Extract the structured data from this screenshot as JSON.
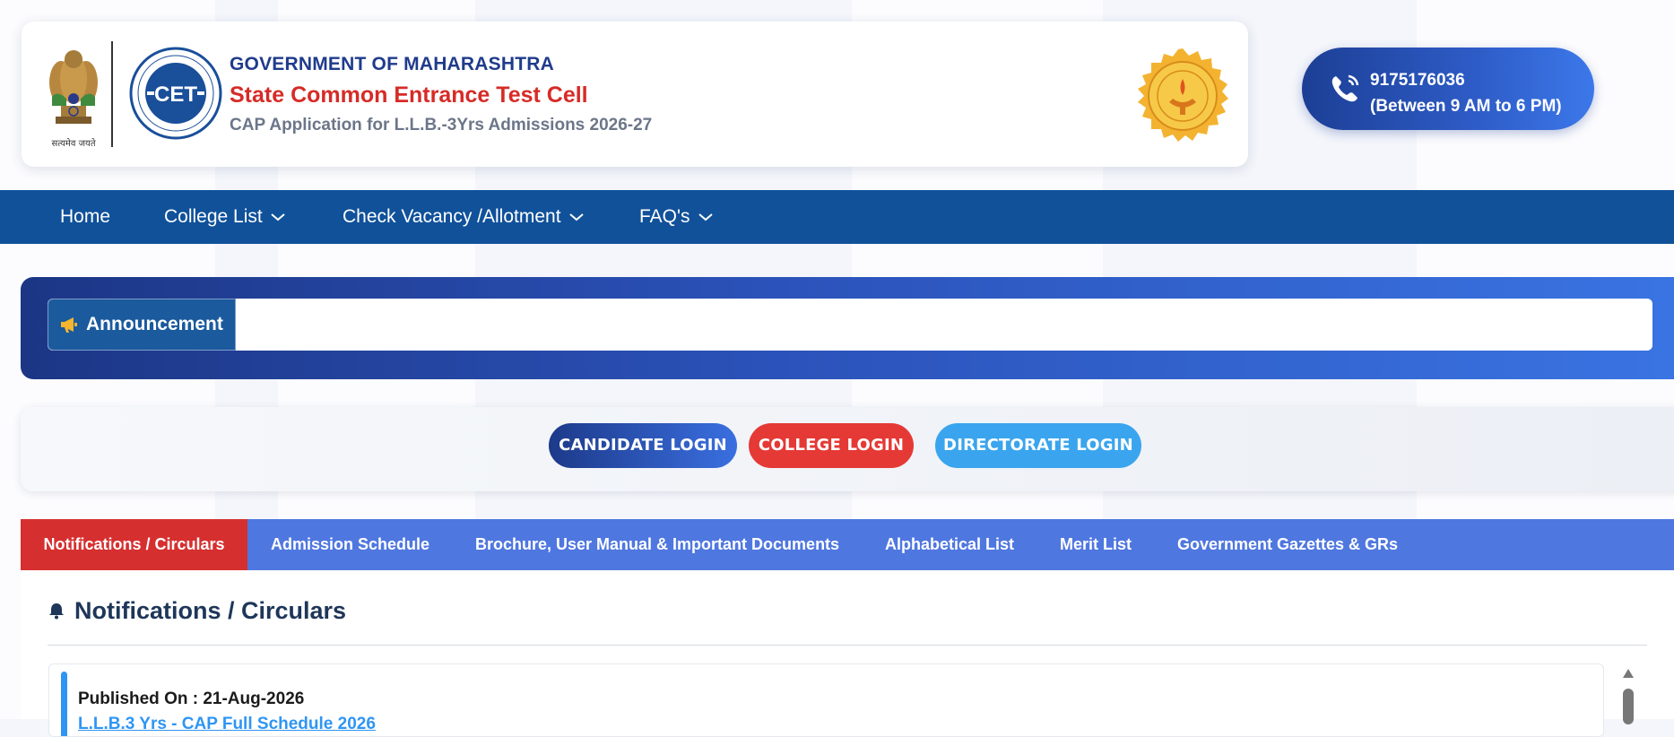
{
  "header": {
    "emblem_motto": "सत्यमेव जयते",
    "government": "GOVERNMENT OF MAHARASHTRA",
    "cell_name": "State Common Entrance Test Cell",
    "application_title": "CAP Application for L.L.B.-3Yrs Admissions 2026-27",
    "cet_logo_text": "CET"
  },
  "contact": {
    "phone": "9175176036",
    "hours": "(Between 9 AM to 6 PM)",
    "icon": "phone-icon"
  },
  "nav": {
    "home": "Home",
    "college_list": "College List",
    "check_vacancy": "Check Vacancy /Allotment",
    "faqs": "FAQ's"
  },
  "announcement": {
    "label": "Announcement",
    "icon": "megaphone-icon",
    "text": ""
  },
  "logins": {
    "candidate": "CANDIDATE LOGIN",
    "college": "COLLEGE LOGIN",
    "directorate": "DIRECTORATE LOGIN"
  },
  "tabs": [
    {
      "label": "Notifications / Circulars",
      "active": true
    },
    {
      "label": "Admission Schedule",
      "active": false
    },
    {
      "label": "Brochure, User Manual & Important Documents",
      "active": false
    },
    {
      "label": "Alphabetical List",
      "active": false
    },
    {
      "label": "Merit List",
      "active": false
    },
    {
      "label": "Government Gazettes & GRs",
      "active": false
    }
  ],
  "notifications": {
    "heading": "Notifications / Circulars",
    "items": [
      {
        "published": "Published On : 21-Aug-2026",
        "title": "L.L.B.3 Yrs - CAP Full Schedule 2026"
      }
    ]
  },
  "colors": {
    "nav": "#10519a",
    "accent_red": "#d62f2f",
    "tab_bar": "#4f77e0",
    "link_blue": "#2f95f3"
  }
}
